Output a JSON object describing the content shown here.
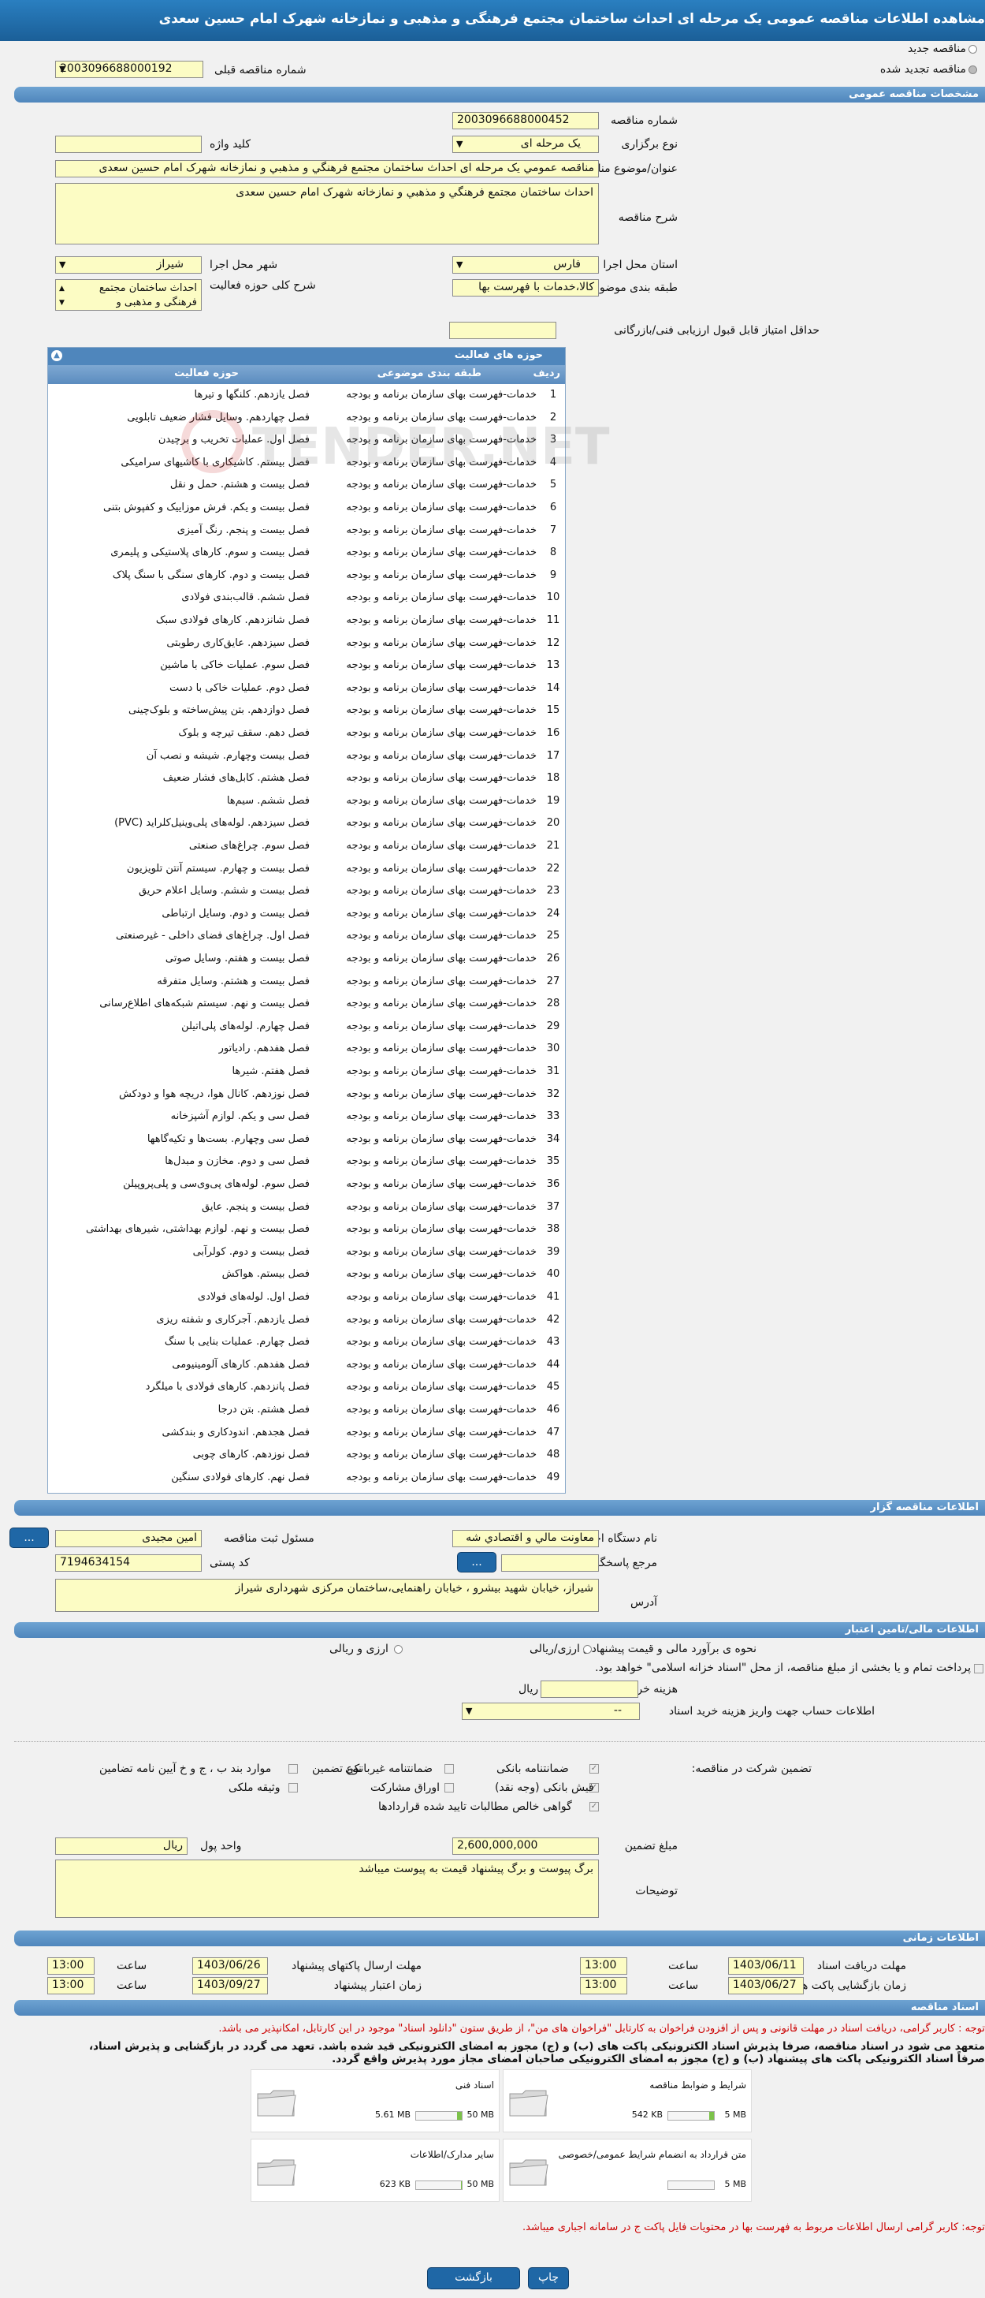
{
  "header": {
    "title": "مشاهده اطلاعات مناقصه عمومی یک مرحله ای احداث ساختمان مجتمع فرهنگی و مذهبی و نمازخانه شهرک امام حسین سعدی"
  },
  "top": {
    "new_tender": "مناقصه جدید",
    "renewed_tender": "مناقصه تجدید شده",
    "prev_number_label": "شماره مناقصه قبلی",
    "prev_number_value": "2003096688000192"
  },
  "general": {
    "section_title": "مشخصات مناقصه عمومی",
    "number_label": "شماره مناقصه",
    "number_value": "2003096688000452",
    "type_label": "نوع برگزاری",
    "type_value": "یک مرحله ای",
    "keyword_label": "کلید واژه",
    "keyword_value": "",
    "subject_label": "عنوان/موضوع مناقصه",
    "subject_value": "مناقصه عمومي يک مرحله ای احداث ساختمان مجتمع فرهنگي و مذهبي و نمازخانه شهرک امام حسين سعدی",
    "desc_label": "شرح مناقصه",
    "desc_value": "احداث ساختمان مجتمع فرهنگي و مذهبي و نمازخانه شهرک امام حسين سعدی",
    "province_label": "استان محل اجرا",
    "province_value": "فارس",
    "city_label": "شهر محل اجرا",
    "city_value": "شیراز",
    "category_label": "طبقه بندی موضوعی",
    "category_value": "کالا،خدمات با فهرست بها",
    "scope_label": "شرح کلی حوزه فعالیت",
    "scope_value": "احداث ساختمان مجتمع فرهنگی و مذهبی و",
    "min_score_label": "حداقل امتياز قابل قبول ارزيابی فنی/بازرگانی",
    "min_score_value": ""
  },
  "activity": {
    "title": "حوزه های فعالیت",
    "col_row": "ردیف",
    "col_category": "طبقه بندی موضوعی",
    "col_field": "حوزه فعالیت",
    "rows": [
      [
        "1",
        "خدمات-فهرست بهای سازمان برنامه و بودجه",
        "فصل یازدهم. کلنگها و تیرها"
      ],
      [
        "2",
        "خدمات-فهرست بهای سازمان برنامه و بودجه",
        "فصل چهاردهم. وسایل فشار ضعیف تابلویی"
      ],
      [
        "3",
        "خدمات-فهرست بهای سازمان برنامه و بودجه",
        "فصل اول. عملیات تخریب و برچیدن"
      ],
      [
        "4",
        "خدمات-فهرست بهای سازمان برنامه و بودجه",
        "فصل بیستم. کاشیکاری با کاشیهای سرامیکی"
      ],
      [
        "5",
        "خدمات-فهرست بهای سازمان برنامه و بودجه",
        "فصل بیست و هشتم. حمل و نقل"
      ],
      [
        "6",
        "خدمات-فهرست بهای سازمان برنامه و بودجه",
        "فصل بیست و یکم. فرش موزاییک و کفپوش بتنی"
      ],
      [
        "7",
        "خدمات-فهرست بهای سازمان برنامه و بودجه",
        "فصل بیست و پنجم. رنگ آمیزی"
      ],
      [
        "8",
        "خدمات-فهرست بهای سازمان برنامه و بودجه",
        "فصل بیست و سوم. کارهای پلاستیکی و پلیمری"
      ],
      [
        "9",
        "خدمات-فهرست بهای سازمان برنامه و بودجه",
        "فصل بیست و دوم. کارهای سنگی با سنگ پلاک"
      ],
      [
        "10",
        "خدمات-فهرست بهای سازمان برنامه و بودجه",
        "فصل ششم. قالب‌بندی فولادی"
      ],
      [
        "11",
        "خدمات-فهرست بهای سازمان برنامه و بودجه",
        "فصل شانزدهم. کارهای فولادی سبک"
      ],
      [
        "12",
        "خدمات-فهرست بهای سازمان برنامه و بودجه",
        "فصل سیزدهم. عایق‌کاری رطوبتی"
      ],
      [
        "13",
        "خدمات-فهرست بهای سازمان برنامه و بودجه",
        "فصل سوم. عملیات خاکی با ماشین"
      ],
      [
        "14",
        "خدمات-فهرست بهای سازمان برنامه و بودجه",
        "فصل دوم. عملیات خاکی با دست"
      ],
      [
        "15",
        "خدمات-فهرست بهای سازمان برنامه و بودجه",
        "فصل دوازدهم. بتن پیش‌ساخته و بلوک‌چینی"
      ],
      [
        "16",
        "خدمات-فهرست بهای سازمان برنامه و بودجه",
        "فصل دهم. سقف تیرچه و بلوک"
      ],
      [
        "17",
        "خدمات-فهرست بهای سازمان برنامه و بودجه",
        "فصل بیست وچهارم. شیشه و نصب آن"
      ],
      [
        "18",
        "خدمات-فهرست بهای سازمان برنامه و بودجه",
        "فصل هشتم. کابل‌های فشار ضعیف"
      ],
      [
        "19",
        "خدمات-فهرست بهای سازمان برنامه و بودجه",
        "فصل ششم. سیم‌ها"
      ],
      [
        "20",
        "خدمات-فهرست بهای سازمان برنامه و بودجه",
        "فصل سیزدهم. لوله‌های پلی‌وینیل‌کلراید (PVC)"
      ],
      [
        "21",
        "خدمات-فهرست بهای سازمان برنامه و بودجه",
        "فصل سوم. چراغ‌های صنعتی"
      ],
      [
        "22",
        "خدمات-فهرست بهای سازمان برنامه و بودجه",
        "فصل بیست و چهارم. سیستم آنتن تلویزیون"
      ],
      [
        "23",
        "خدمات-فهرست بهای سازمان برنامه و بودجه",
        "فصل بیست و ششم. وسایل اعلام حریق"
      ],
      [
        "24",
        "خدمات-فهرست بهای سازمان برنامه و بودجه",
        "فصل بیست و دوم. وسایل ارتباطی"
      ],
      [
        "25",
        "خدمات-فهرست بهای سازمان برنامه و بودجه",
        "فصل اول. چراغ‌های فضای داخلی - غیرصنعتی"
      ],
      [
        "26",
        "خدمات-فهرست بهای سازمان برنامه و بودجه",
        "فصل بیست و هفتم. وسایل صوتی"
      ],
      [
        "27",
        "خدمات-فهرست بهای سازمان برنامه و بودجه",
        "فصل بیست و هشتم. وسایل متفرقه"
      ],
      [
        "28",
        "خدمات-فهرست بهای سازمان برنامه و بودجه",
        "فصل بیست و نهم. سیستم شبکه‌های اطلاع‌رسانی"
      ],
      [
        "29",
        "خدمات-فهرست بهای سازمان برنامه و بودجه",
        "فصل چهارم. لوله‌های پلی‌اتیلن"
      ],
      [
        "30",
        "خدمات-فهرست بهای سازمان برنامه و بودجه",
        "فصل هفدهم. رادیاتور"
      ],
      [
        "31",
        "خدمات-فهرست بهای سازمان برنامه و بودجه",
        "فصل هفتم. شیرها"
      ],
      [
        "32",
        "خدمات-فهرست بهای سازمان برنامه و بودجه",
        "فصل نوزدهم. کانال هوا، دریچه هوا و دودکش"
      ],
      [
        "33",
        "خدمات-فهرست بهای سازمان برنامه و بودجه",
        "فصل سی و یکم. لوازم آشپزخانه"
      ],
      [
        "34",
        "خدمات-فهرست بهای سازمان برنامه و بودجه",
        "فصل سی وچهارم. بست‌ها و تکیه‌گاهها"
      ],
      [
        "35",
        "خدمات-فهرست بهای سازمان برنامه و بودجه",
        "فصل سی و دوم. مخازن و مبدل‌ها"
      ],
      [
        "36",
        "خدمات-فهرست بهای سازمان برنامه و بودجه",
        "فصل سوم. لوله‌های پی‌وی‌سی و پلی‌پروپیلن"
      ],
      [
        "37",
        "خدمات-فهرست بهای سازمان برنامه و بودجه",
        "فصل بیست و پنجم. عایق"
      ],
      [
        "38",
        "خدمات-فهرست بهای سازمان برنامه و بودجه",
        "فصل بیست و نهم. لوازم بهداشتی، شیرهای بهداشتی"
      ],
      [
        "39",
        "خدمات-فهرست بهای سازمان برنامه و بودجه",
        "فصل بیست و دوم. کولرآبی"
      ],
      [
        "40",
        "خدمات-فهرست بهای سازمان برنامه و بودجه",
        "فصل بیستم. هواکش"
      ],
      [
        "41",
        "خدمات-فهرست بهای سازمان برنامه و بودجه",
        "فصل اول. لوله‌های فولادی"
      ],
      [
        "42",
        "خدمات-فهرست بهای سازمان برنامه و بودجه",
        "فصل یازدهم. آجرکاری و شفته ریزی"
      ],
      [
        "43",
        "خدمات-فهرست بهای سازمان برنامه و بودجه",
        "فصل چهارم. عملیات بنایی با سنگ"
      ],
      [
        "44",
        "خدمات-فهرست بهای سازمان برنامه و بودجه",
        "فصل هفدهم. کارهای آلومینیومی"
      ],
      [
        "45",
        "خدمات-فهرست بهای سازمان برنامه و بودجه",
        "فصل پانزدهم. کارهای فولادی با میلگرد"
      ],
      [
        "46",
        "خدمات-فهرست بهای سازمان برنامه و بودجه",
        "فصل هشتم. بتن درجا"
      ],
      [
        "47",
        "خدمات-فهرست بهای سازمان برنامه و بودجه",
        "فصل هجدهم. اندودکاری و بندکشی"
      ],
      [
        "48",
        "خدمات-فهرست بهای سازمان برنامه و بودجه",
        "فصل نوزدهم. کارهای چوبی"
      ],
      [
        "49",
        "خدمات-فهرست بهای سازمان برنامه و بودجه",
        "فصل نهم. کارهای فولادی سنگین"
      ]
    ]
  },
  "organizer": {
    "section_title": "اطلاعات مناقصه گزار",
    "org_label": "نام دستگاه اجرایی مناقصه گزار",
    "org_value": "معاونت مالي و اقتصادي شه",
    "resp_label": "مسئول ثبت مناقصه",
    "resp_value": "امين مجيدی",
    "dots_label": "...",
    "ref_label": "مرجع پاسخگویی",
    "ref_value": "",
    "postal_label": "کد پستی",
    "postal_value": "7194634154",
    "address_label": "آدرس",
    "address_value": "شیراز، خیابان شهید بیشرو ، خیابان راهنمایی،ساختمان مرکزی شهرداری شیراز"
  },
  "finance": {
    "section_title": "اطلاعات مالی/تامین اعتبار",
    "estimate_label": "نحوه ی برآورد مالی و قیمت پیشنهادی",
    "rial": "ارزی/ریالی",
    "fx_rial": "ارزی و ریالی",
    "pay_label": "پرداخت تمام و یا بخشی از مبلغ مناقصه، از محل \"اسناد خزانه اسلامی\" خواهد بود.",
    "doc_cost_label": "هزینه خرید اسناد",
    "doc_cost_unit": "ریال",
    "account_label": "اطلاعات حساب جهت واریز هزینه خرید اسناد",
    "account_value": "--"
  },
  "guarantee": {
    "label": "تضمین شرکت در مناقصه:",
    "type_label": "نوع تضمین",
    "bank": "ضمانتنامه بانکی",
    "nonbank": "ضمانتنامه غیربانکی",
    "clause": "موارد بند ب ، ج و خ آیین نامه تضامین",
    "cash": "فیش بانکی (وجه نقد)",
    "bonds": "اوراق مشارکت",
    "property": "وثیقه ملکی",
    "receivables": "گواهی خالص مطالبات تایید شده قراردادها",
    "amount_label": "مبلغ تضمین",
    "amount_value": "2,600,000,000",
    "currency_label": "واحد پول",
    "currency_value": "ریال",
    "notes_label": "توضیحات",
    "notes_value": "برگ پیوست و برگ پیشنهاد قیمت به پیوست میباشد"
  },
  "timing": {
    "section_title": "اطلاعات زمانی",
    "recv_label": "مهلت دریافت اسناد",
    "recv_date": "1403/06/11",
    "recv_time": "13:00",
    "send_label": "مهلت ارسال پاکتهای پیشنهاد",
    "send_date": "1403/06/26",
    "send_time": "13:00",
    "open_label": "زمان بازگشایی پاکت ها",
    "open_date": "1403/06/27",
    "open_time": "13:00",
    "valid_label": "زمان اعتبار پیشنهاد",
    "valid_date": "1403/09/27",
    "valid_time": "13:00",
    "time_label": "ساعت"
  },
  "docs": {
    "section_title": "اسناد مناقصه",
    "note1": "توجه : کاربر گرامی، دریافت اسناد در مهلت قانونی و پس از افزودن فراخوان به کارتابل \"فراخوان های من\"، از طریق ستون \"دانلود اسناد\" موجود در این کارتابل، امکانپذیر می باشد.",
    "note2": "متعهد می شود در اسناد مناقصه، صرفا پذیرش اسناد الکترونیکی پاکت های (ب) و (ج) مجوز به امضای الکترونیکی قید شده باشد. تعهد می گردد در بازگشایی و پذیرش اسناد،",
    "note3": "صرفاً اسناد الکترونیکی پاکت های پیشنهاد (ب) و (ج) مجوز به امضای الکترونیکی صاحبان امضای مجاز مورد پذیرش واقع گردد.",
    "files": [
      {
        "name": "شرایط و ضوابط مناقصه",
        "size": "542 KB",
        "max": "5 MB",
        "fill": 0.1
      },
      {
        "name": "اسناد فنی",
        "size": "5.61 MB",
        "max": "50 MB",
        "fill": 0.11
      },
      {
        "name": "متن قرارداد به انضمام شرایط عمومی/خصوصی",
        "size": "",
        "max": "5 MB",
        "fill": 0
      },
      {
        "name": "سایر مدارک/اطلاعات",
        "size": "623 KB",
        "max": "50 MB",
        "fill": 0.02
      }
    ],
    "note4": "توجه: کاربر گرامی ارسال اطلاعات مربوط به فهرست بها در محتویات فایل پاکت ج در سامانه اجباری میباشد."
  },
  "footer": {
    "back": "بازگشت",
    "print": "چاپ"
  }
}
